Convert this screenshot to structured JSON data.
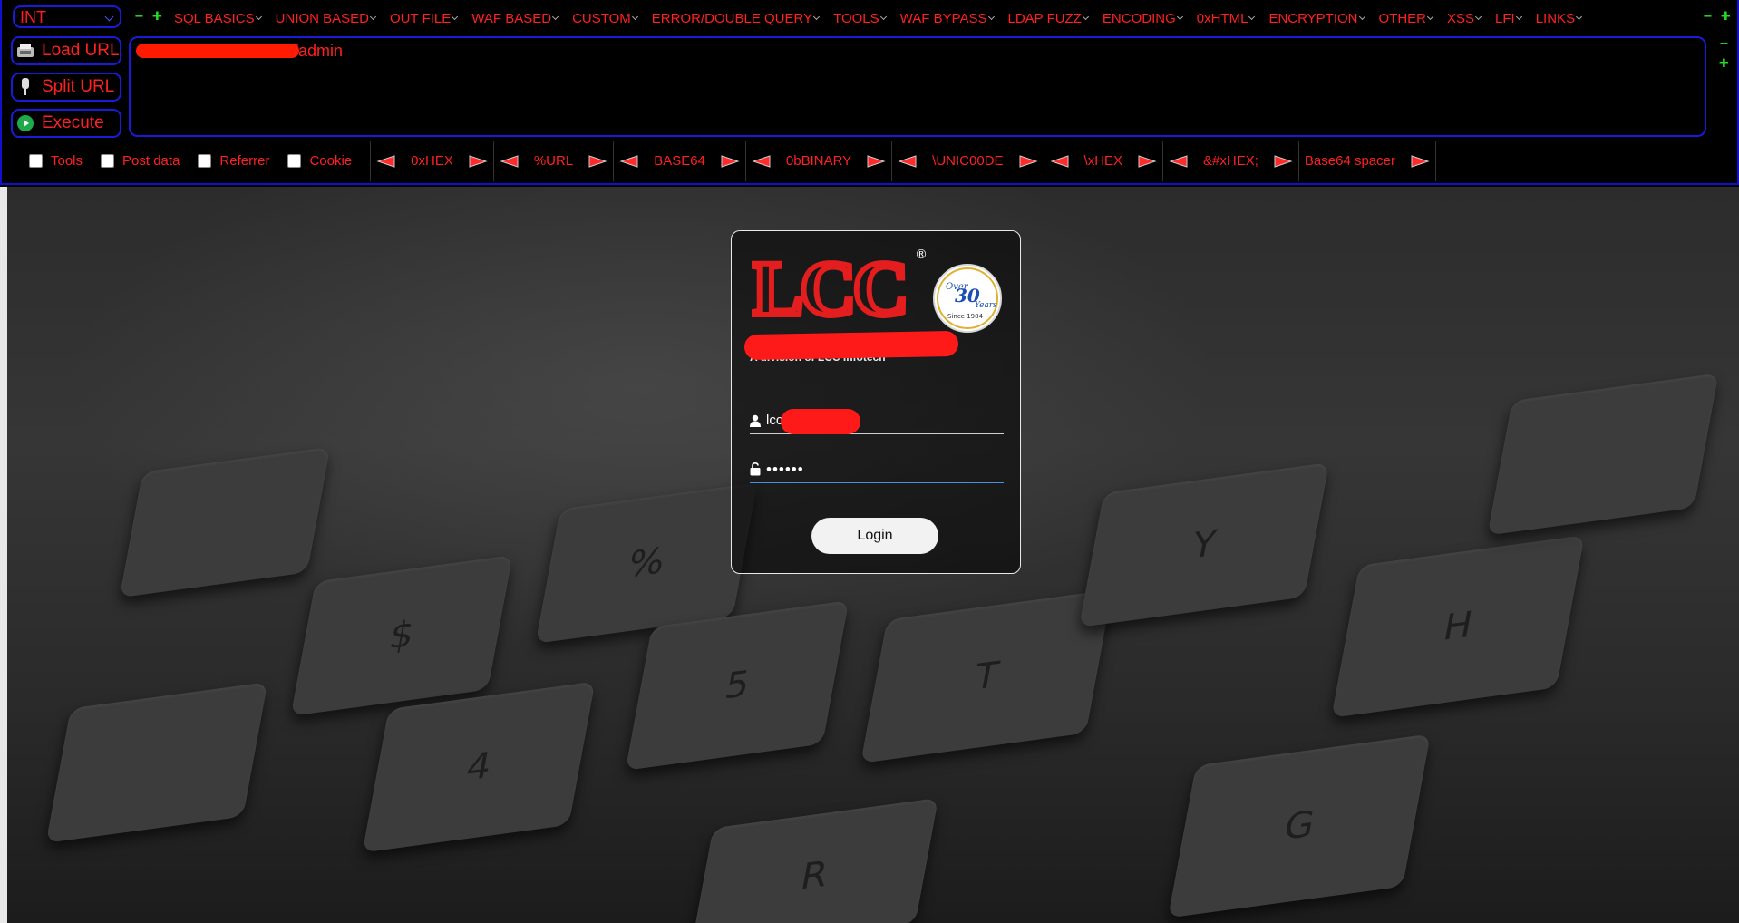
{
  "hackbar": {
    "type_select": "INT",
    "menu": [
      "SQL BASICS",
      "UNION BASED",
      "OUT FILE",
      "WAF BASED",
      "CUSTOM",
      "ERROR/DOUBLE QUERY",
      "TOOLS",
      "WAF BYPASS",
      "LDAP FUZZ",
      "ENCODING",
      "0xHTML",
      "ENCRYPTION",
      "OTHER",
      "XSS",
      "LFI",
      "LINKS"
    ],
    "buttons": {
      "load_url": "Load URL",
      "split_url": "Split URL",
      "execute": "Execute"
    },
    "url_value": "/admin",
    "options": {
      "tools": "Tools",
      "post_data": "Post data",
      "referrer": "Referrer",
      "cookie": "Cookie"
    },
    "encoders": [
      "0xHEX",
      "%URL",
      "BASE64",
      "0bBINARY",
      "\\UNIC00DE",
      "\\xHEX",
      "&#xHEX;",
      "Base64 spacer"
    ],
    "colors": {
      "accent_text": "#ff2020",
      "border": "#1a1ad8",
      "mini_buttons": "#22dd22"
    }
  },
  "login": {
    "logo_text": "LCC",
    "registered_mark": "®",
    "badge": {
      "top": "Over",
      "number": "30",
      "unit": "Years",
      "since": "Since 1984"
    },
    "tagline": "A division of LCC Infotech",
    "username_value": "lcc",
    "password_value": "••••••",
    "login_button": "Login",
    "colors": {
      "logo_red": "#e41e1e",
      "badge_blue": "#1a4fb0"
    }
  },
  "background": {
    "keys": [
      "$",
      "4",
      "%",
      "5",
      "R",
      "T",
      "G",
      "H",
      "Y"
    ]
  }
}
